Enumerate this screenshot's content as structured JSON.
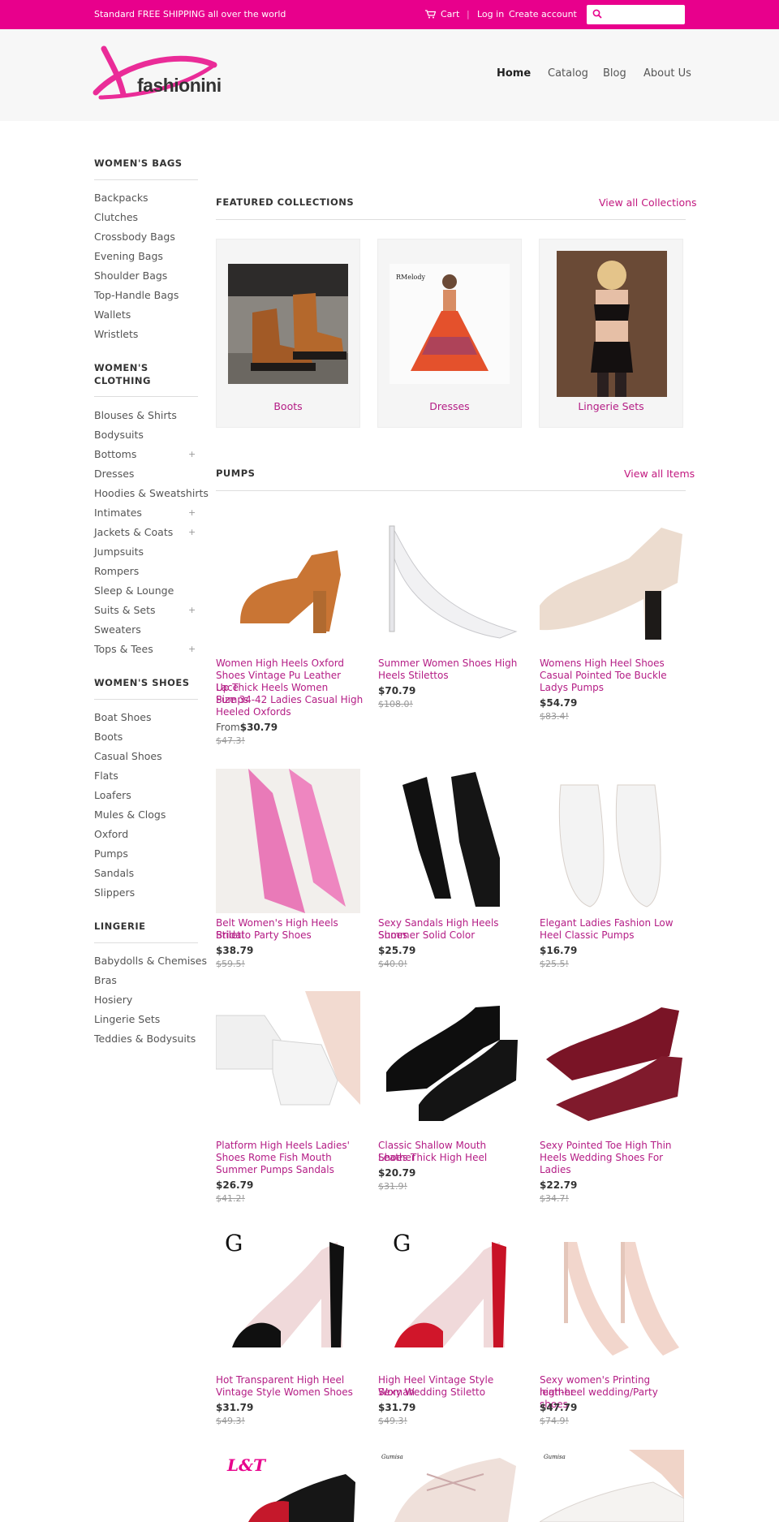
{
  "topbar": {
    "shipping": "Standard FREE SHIPPING all over the world",
    "cart": "Cart",
    "login": "Log in",
    "create": "Create account",
    "search_placeholder": ""
  },
  "brand": {
    "logo_text": "fashionini",
    "accent": "#e8008c"
  },
  "nav": [
    "Home",
    "Catalog",
    "Blog",
    "About Us"
  ],
  "sidebar": {
    "bags": {
      "title": "WOMEN'S BAGS",
      "items": [
        "Backpacks",
        "Clutches",
        "Crossbody Bags",
        "Evening Bags",
        "Shoulder Bags",
        "Top-Handle Bags",
        "Wallets",
        "Wristlets"
      ]
    },
    "clothing": {
      "title_1": "WOMEN'S",
      "title_2": "CLOTHING",
      "items": [
        "Blouses & Shirts",
        "Bodysuits",
        "Bottoms",
        "Dresses",
        "Hoodies & Sweatshirts",
        "Intimates",
        "Jackets & Coats",
        "Jumpsuits",
        "Rompers",
        "Sleep & Lounge",
        "Suits & Sets",
        "Sweaters",
        "Tops & Tees"
      ],
      "plus": "+"
    },
    "shoes": {
      "title": "WOMEN'S SHOES",
      "items": [
        "Boat Shoes",
        "Boots",
        "Casual Shoes",
        "Flats",
        "Loafers",
        "Mules & Clogs",
        "Oxford",
        "Pumps",
        "Sandals",
        "Slippers"
      ]
    },
    "lingerie": {
      "title": "LINGERIE",
      "items": [
        "Babydolls & Chemises",
        "Bras",
        "Hosiery",
        "Lingerie Sets",
        "Teddies & Bodysuits"
      ]
    }
  },
  "featured": {
    "title": "FEATURED COLLECTIONS",
    "link": "View all Collections",
    "items": [
      "Boots",
      "Dresses",
      "Lingerie Sets"
    ],
    "dress_brand": "RMelody"
  },
  "pumps": {
    "title": "PUMPS",
    "link": "View all Items",
    "products": [
      {
        "t1": "Women High Heels Oxford",
        "t2": "Shoes Vintage Pu Leather Lace",
        "t3": "Up Thick Heels Women Pumps",
        "t4": "Size 34-42 Ladies Casual High",
        "t5": "Heeled Oxfords",
        "from": "From",
        "price": "$30.79",
        "old": "$47.3!"
      },
      {
        "t1": "Summer Women Shoes High",
        "t2": "Heels Stilettos",
        "price": "$70.79",
        "old": "$108.0!"
      },
      {
        "t1": "Womens High Heel Shoes",
        "t2": "Casual Pointed Toe Buckle",
        "t3": "Ladys Pumps",
        "price": "$54.79",
        "old": "$83.4!"
      },
      {
        "t1": "Belt Women's High Heels Bridal",
        "t2": "Stiletto Party Shoes",
        "price": "$38.79",
        "old": "$59.5!"
      },
      {
        "t1": "Sexy Sandals High Heels Shoes",
        "t2": "Summer Solid Color",
        "price": "$25.79",
        "old": "$40.0!"
      },
      {
        "t1": "Elegant Ladies Fashion Low",
        "t2": "Heel Classic Pumps",
        "price": "$16.79",
        "old": "$25.5!"
      },
      {
        "t1": "Platform High Heels Ladies'",
        "t2": "Shoes Rome Fish Mouth",
        "t3": "Summer Pumps Sandals",
        "price": "$26.79",
        "old": "$41.2!"
      },
      {
        "t1": "Classic Shallow Mouth Leather",
        "t2": "Shoes Thick High Heel",
        "price": "$20.79",
        "old": "$31.9!"
      },
      {
        "t1": "Sexy Pointed Toe High Thin",
        "t2": "Heels Wedding Shoes For",
        "t3": "Ladies",
        "price": "$22.79",
        "old": "$34.7!"
      },
      {
        "t1": "Hot Transparent High Heel",
        "t2": "Vintage Style Women Shoes",
        "price": "$31.79",
        "old": "$49.3!"
      },
      {
        "t1": "High Heel Vintage Style Woman",
        "t2": "Sexy Wedding Stiletto",
        "price": "$31.79",
        "old": "$49.3!"
      },
      {
        "t1": "Sexy women's Printing leather",
        "t2": "high-heel wedding/Party shoes",
        "price": "$47.79",
        "old": "$74.9!"
      }
    ],
    "watermarks": {
      "g": "G",
      "lt": "L&T",
      "gumisa": "Gumisa"
    }
  }
}
